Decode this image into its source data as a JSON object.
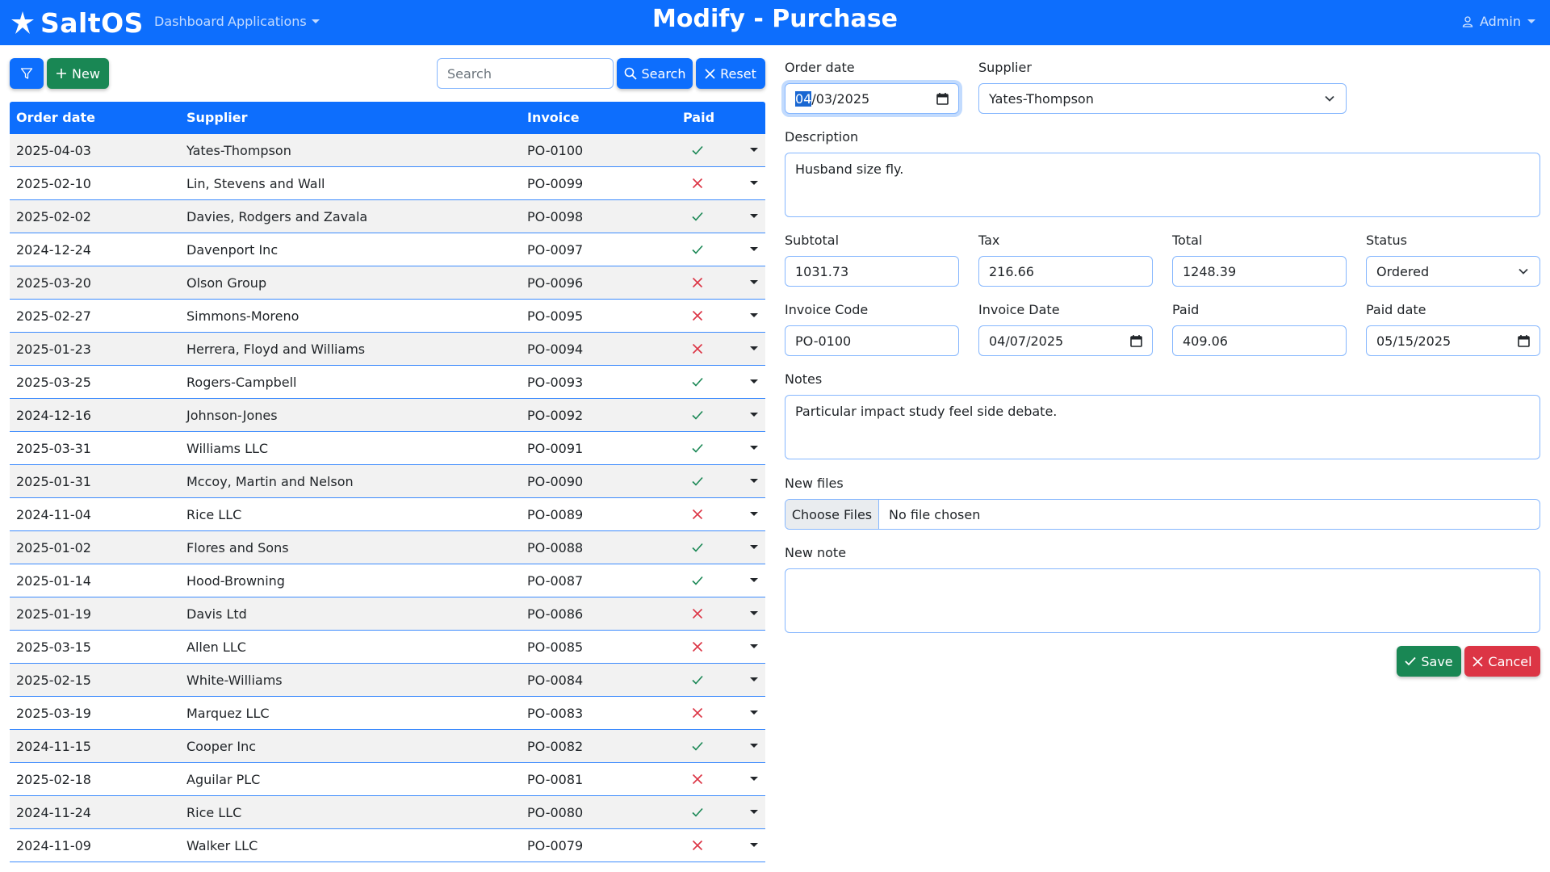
{
  "navbar": {
    "brand": "SaltOS",
    "dashboard": "Dashboard",
    "applications": "Applications",
    "title": "Modify - Purchase",
    "user": "Admin"
  },
  "toolbar": {
    "new_label": "New",
    "search_placeholder": "Search",
    "search_label": "Search",
    "reset_label": "Reset"
  },
  "table": {
    "headers": {
      "order_date": "Order date",
      "supplier": "Supplier",
      "invoice": "Invoice",
      "paid": "Paid"
    },
    "rows": [
      {
        "order_date": "2025-04-03",
        "supplier": "Yates-Thompson",
        "invoice": "PO-0100",
        "paid": true
      },
      {
        "order_date": "2025-02-10",
        "supplier": "Lin, Stevens and Wall",
        "invoice": "PO-0099",
        "paid": false
      },
      {
        "order_date": "2025-02-02",
        "supplier": "Davies, Rodgers and Zavala",
        "invoice": "PO-0098",
        "paid": true
      },
      {
        "order_date": "2024-12-24",
        "supplier": "Davenport Inc",
        "invoice": "PO-0097",
        "paid": true
      },
      {
        "order_date": "2025-03-20",
        "supplier": "Olson Group",
        "invoice": "PO-0096",
        "paid": false
      },
      {
        "order_date": "2025-02-27",
        "supplier": "Simmons-Moreno",
        "invoice": "PO-0095",
        "paid": false
      },
      {
        "order_date": "2025-01-23",
        "supplier": "Herrera, Floyd and Williams",
        "invoice": "PO-0094",
        "paid": false
      },
      {
        "order_date": "2025-03-25",
        "supplier": "Rogers-Campbell",
        "invoice": "PO-0093",
        "paid": true
      },
      {
        "order_date": "2024-12-16",
        "supplier": "Johnson-Jones",
        "invoice": "PO-0092",
        "paid": true
      },
      {
        "order_date": "2025-03-31",
        "supplier": "Williams LLC",
        "invoice": "PO-0091",
        "paid": true
      },
      {
        "order_date": "2025-01-31",
        "supplier": "Mccoy, Martin and Nelson",
        "invoice": "PO-0090",
        "paid": true
      },
      {
        "order_date": "2024-11-04",
        "supplier": "Rice LLC",
        "invoice": "PO-0089",
        "paid": false
      },
      {
        "order_date": "2025-01-02",
        "supplier": "Flores and Sons",
        "invoice": "PO-0088",
        "paid": true
      },
      {
        "order_date": "2025-01-14",
        "supplier": "Hood-Browning",
        "invoice": "PO-0087",
        "paid": true
      },
      {
        "order_date": "2025-01-19",
        "supplier": "Davis Ltd",
        "invoice": "PO-0086",
        "paid": false
      },
      {
        "order_date": "2025-03-15",
        "supplier": "Allen LLC",
        "invoice": "PO-0085",
        "paid": false
      },
      {
        "order_date": "2025-02-15",
        "supplier": "White-Williams",
        "invoice": "PO-0084",
        "paid": true
      },
      {
        "order_date": "2025-03-19",
        "supplier": "Marquez LLC",
        "invoice": "PO-0083",
        "paid": false
      },
      {
        "order_date": "2024-11-15",
        "supplier": "Cooper Inc",
        "invoice": "PO-0082",
        "paid": true
      },
      {
        "order_date": "2025-02-18",
        "supplier": "Aguilar PLC",
        "invoice": "PO-0081",
        "paid": false
      },
      {
        "order_date": "2024-11-24",
        "supplier": "Rice LLC",
        "invoice": "PO-0080",
        "paid": true
      },
      {
        "order_date": "2024-11-09",
        "supplier": "Walker LLC",
        "invoice": "PO-0079",
        "paid": false
      }
    ]
  },
  "form": {
    "order_date_label": "Order date",
    "order_date_month": "04",
    "order_date_rest": "/03/2025",
    "supplier_label": "Supplier",
    "supplier_value": "Yates-Thompson",
    "description_label": "Description",
    "description_value": "Husband size fly.",
    "subtotal_label": "Subtotal",
    "subtotal_value": "1031.73",
    "tax_label": "Tax",
    "tax_value": "216.66",
    "total_label": "Total",
    "total_value": "1248.39",
    "status_label": "Status",
    "status_value": "Ordered",
    "invoice_code_label": "Invoice Code",
    "invoice_code_value": "PO-0100",
    "invoice_date_label": "Invoice Date",
    "invoice_date_value": "04/07/2025",
    "paid_label": "Paid",
    "paid_value": "409.06",
    "paid_date_label": "Paid date",
    "paid_date_value": "05/15/2025",
    "notes_label": "Notes",
    "notes_value": "Particular impact study feel side debate.",
    "new_files_label": "New files",
    "choose_files": "Choose Files",
    "no_file": "No file chosen",
    "new_note_label": "New note",
    "save_label": "Save",
    "cancel_label": "Cancel"
  },
  "colors": {
    "primary": "#0d6efd",
    "success": "#198754",
    "danger": "#dc3545"
  },
  "icons": [
    "filter-icon",
    "plus-icon",
    "search-icon",
    "x-icon",
    "check-icon",
    "calendar-icon",
    "chevron-down-icon",
    "user-icon"
  ]
}
